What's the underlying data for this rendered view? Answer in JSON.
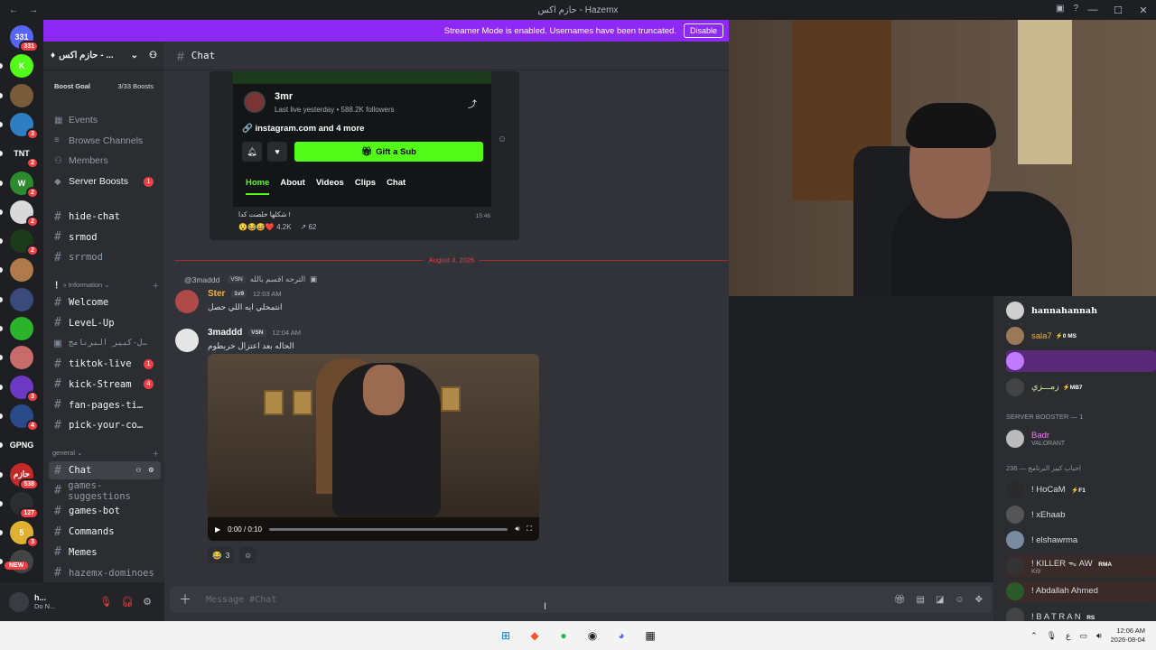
{
  "titlebar": {
    "title": "حازم اكس - Hazemx",
    "back": "←",
    "forward": "→"
  },
  "banner": {
    "text": "Streamer Mode is enabled. Usernames have been truncated.",
    "disable_label": "Disable"
  },
  "guilds": [
    {
      "label": "331",
      "color": "#5865f2",
      "badge": "331"
    },
    {
      "label": "K",
      "color": "#53fc18",
      "badge": ""
    },
    {
      "label": "",
      "color": "#7a5c3a",
      "badge": ""
    },
    {
      "label": "",
      "color": "#2e7ec4",
      "badge": "3"
    },
    {
      "label": "TNT",
      "color": "#1e1f22",
      "badge": "2"
    },
    {
      "label": "W",
      "color": "#2d8a2d",
      "badge": "2"
    },
    {
      "label": "",
      "color": "#d9d9d9",
      "badge": "2"
    },
    {
      "label": "",
      "color": "#1a3a1a",
      "badge": "2"
    },
    {
      "label": "",
      "color": "#b07a4a",
      "badge": ""
    },
    {
      "label": "",
      "color": "#3a4a7a",
      "badge": ""
    },
    {
      "label": "",
      "color": "#2bb32b",
      "badge": ""
    },
    {
      "label": "",
      "color": "#c76b6b",
      "badge": ""
    },
    {
      "label": "",
      "color": "#6c3ac2",
      "badge": "3"
    },
    {
      "label": "",
      "color": "#2a4a8a",
      "badge": "4"
    },
    {
      "label": "GPNG",
      "color": "#1e1f22",
      "badge": ""
    },
    {
      "label": "حازم",
      "color": "#c22a2a",
      "badge": "538"
    },
    {
      "label": "",
      "color": "#2b2d31",
      "badge": "127"
    },
    {
      "label": "5",
      "color": "#e0b030",
      "badge": "3"
    },
    {
      "label": "",
      "color": "#444",
      "badge": ""
    }
  ],
  "new_label": "NEW",
  "server": {
    "name": "حازم اكس - ...",
    "boost_goal": "Boost Goal",
    "boost_count": "3/33 Boosts"
  },
  "sidebar": {
    "general_items": [
      {
        "label": "Events",
        "icon": "calendar-icon"
      },
      {
        "label": "Browse Channels",
        "icon": "list-icon"
      },
      {
        "label": "Members",
        "icon": "people-icon"
      },
      {
        "label": "Server Boosts",
        "icon": "boost-icon",
        "badge": "1"
      }
    ],
    "channels_top": [
      {
        "label": "hide-chat"
      },
      {
        "label": "srmod"
      },
      {
        "label": "srrmod"
      }
    ],
    "category_information": "» Information",
    "channels_info": [
      {
        "label": "Welcome"
      },
      {
        "label": "LeveL-Up"
      },
      {
        "label": "سوشيال-كبير البرنامج"
      },
      {
        "label": "tiktok-live",
        "badge": "1"
      },
      {
        "label": "kick-Stream",
        "badge": "4"
      },
      {
        "label": "fan-pages-tiktok..."
      },
      {
        "label": "pick-your-color"
      }
    ],
    "category_general": "general",
    "channels_general": [
      {
        "label": "Chat"
      },
      {
        "label": "games-suggestions"
      },
      {
        "label": "games-bot"
      },
      {
        "label": "Commands"
      },
      {
        "label": "Memes"
      },
      {
        "label": "hazemx-dominoes"
      }
    ]
  },
  "user": {
    "name": "h...",
    "status": "Do N..."
  },
  "chat": {
    "channel": "Chat",
    "embed": {
      "name": "3mr",
      "meta": "Last live yesterday • 588.2K followers",
      "link": "instagram.com and 4 more",
      "gift": "Gift a Sub",
      "tabs": [
        "Home",
        "About",
        "Videos",
        "Clips",
        "Chat"
      ],
      "caption": "شكلها خلصت كدا !",
      "time": "15:46",
      "views": "4.2K",
      "shares": "62"
    },
    "divider_date": "August 4, 2026",
    "reply": {
      "user": "@3maddd",
      "tag": "VSN",
      "text": "الترحه اقسم بالله"
    },
    "msg1": {
      "author": "Ster",
      "tag": "1v9",
      "time": "12:03 AM",
      "text": "انتمحلي ايه اللي حصل"
    },
    "msg2": {
      "author": "3maddd",
      "tag": "VSN",
      "time": "12:04 AM",
      "text": "الحاله بعد اعتزال خربطوم"
    },
    "video": {
      "time": "0:00 / 0:10",
      "progress": 0
    },
    "reaction_count": "3",
    "composer_placeholder": "Message #Chat"
  },
  "members": {
    "top": [
      {
        "name": "hannahannah",
        "color": "#ffffff",
        "tag": ""
      },
      {
        "name": "sala7",
        "color": "#f0b232",
        "tag": "⚡0 MS"
      },
      {
        "name": "ㅤㅤㅤ",
        "color": "#c27aff",
        "tag": ""
      },
      {
        "name": "زمـــزي",
        "color": "#c7f0a0",
        "tag": "⚡MB7"
      }
    ],
    "booster_header": "SERVER BOOSTER — 1",
    "booster": {
      "name": "Badr",
      "color": "#ff73fa",
      "sub": "VALORANT"
    },
    "group2_header": "236 — احباب كبير البرنامج",
    "group2": [
      {
        "name": "! HoCaM",
        "tag": "⚡F1",
        "sub": ""
      },
      {
        "name": "! xEhaab",
        "tag": "",
        "sub": ""
      },
      {
        "name": "! elshawrma",
        "tag": "",
        "sub": ""
      },
      {
        "name": "! KILLER ᯓ AW",
        "tag": "RMA",
        "sub": "Ki9"
      },
      {
        "name": "! Abdallah Ahmed",
        "tag": "",
        "sub": ""
      },
      {
        "name": "! B A T R A N",
        "tag": "RS",
        "sub": ""
      }
    ]
  },
  "taskbar": {
    "time": "12:06 AM",
    "date": "2026-08-04",
    "lang": "ع"
  }
}
